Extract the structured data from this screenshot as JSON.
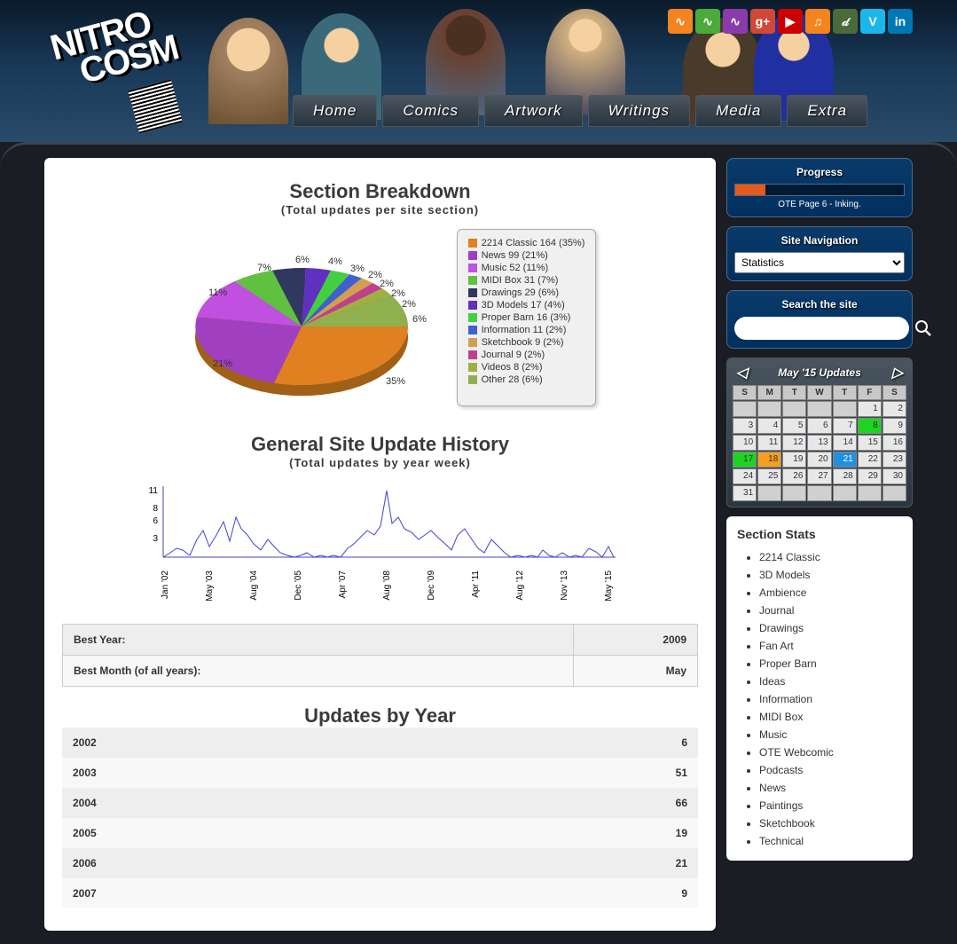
{
  "logo": {
    "line1": "NITRO",
    "line2": "COSM"
  },
  "social": [
    {
      "name": "rss",
      "bg": "#f5841f",
      "glyph": "∿"
    },
    {
      "name": "rss-green",
      "bg": "#4aaa3a",
      "glyph": "∿"
    },
    {
      "name": "rss-purple",
      "bg": "#8a3aaa",
      "glyph": "∿"
    },
    {
      "name": "googleplus",
      "bg": "#d14836",
      "glyph": "g+"
    },
    {
      "name": "youtube",
      "bg": "#cc0000",
      "glyph": "▶"
    },
    {
      "name": "soundcloud",
      "bg": "#f5841f",
      "glyph": "♫"
    },
    {
      "name": "deviantart",
      "bg": "#4a6a3a",
      "glyph": "𝒹"
    },
    {
      "name": "vimeo",
      "bg": "#1ab7ea",
      "glyph": "V"
    },
    {
      "name": "linkedin",
      "bg": "#0077b5",
      "glyph": "in"
    }
  ],
  "nav": [
    "Home",
    "Comics",
    "Artwork",
    "Writings",
    "Media",
    "Extra"
  ],
  "progress": {
    "title": "Progress",
    "pct": 18,
    "text": "OTE Page 6 - Inking."
  },
  "siteNav": {
    "title": "Site Navigation",
    "selected": "Statistics"
  },
  "search": {
    "title": "Search the site",
    "placeholder": ""
  },
  "calendar": {
    "title": "May '15 Updates",
    "dows": [
      "S",
      "M",
      "T",
      "W",
      "T",
      "F",
      "S"
    ],
    "cells": [
      {
        "d": "",
        "c": "empty"
      },
      {
        "d": "",
        "c": "empty"
      },
      {
        "d": "",
        "c": "empty"
      },
      {
        "d": "",
        "c": "empty"
      },
      {
        "d": "",
        "c": "empty"
      },
      {
        "d": "1"
      },
      {
        "d": "2"
      },
      {
        "d": "3"
      },
      {
        "d": "4"
      },
      {
        "d": "5"
      },
      {
        "d": "6"
      },
      {
        "d": "7"
      },
      {
        "d": "8",
        "c": "green"
      },
      {
        "d": "9"
      },
      {
        "d": "10"
      },
      {
        "d": "11"
      },
      {
        "d": "12"
      },
      {
        "d": "13"
      },
      {
        "d": "14"
      },
      {
        "d": "15"
      },
      {
        "d": "16"
      },
      {
        "d": "17",
        "c": "green"
      },
      {
        "d": "18",
        "c": "orange"
      },
      {
        "d": "19"
      },
      {
        "d": "20"
      },
      {
        "d": "21",
        "c": "blue"
      },
      {
        "d": "22"
      },
      {
        "d": "23"
      },
      {
        "d": "24"
      },
      {
        "d": "25"
      },
      {
        "d": "26"
      },
      {
        "d": "27"
      },
      {
        "d": "28"
      },
      {
        "d": "29"
      },
      {
        "d": "30"
      },
      {
        "d": "31"
      },
      {
        "d": "",
        "c": "empty"
      },
      {
        "d": "",
        "c": "empty"
      },
      {
        "d": "",
        "c": "empty"
      },
      {
        "d": "",
        "c": "empty"
      },
      {
        "d": "",
        "c": "empty"
      },
      {
        "d": "",
        "c": "empty"
      }
    ]
  },
  "sectionStats": {
    "title": "Section Stats",
    "items": [
      "2214 Classic",
      "3D Models",
      "Ambience",
      "Journal",
      "Drawings",
      "Fan Art",
      "Proper Barn",
      "Ideas",
      "Information",
      "MIDI Box",
      "Music",
      "OTE Webcomic",
      "Podcasts",
      "News",
      "Paintings",
      "Sketchbook",
      "Technical"
    ]
  },
  "pie": {
    "title": "Section Breakdown",
    "sub": "(Total updates per site section)",
    "legend": [
      {
        "label": "2214 Classic 164 (35%)",
        "color": "#e08020"
      },
      {
        "label": "News 99 (21%)",
        "color": "#a040c0"
      },
      {
        "label": "Music 52 (11%)",
        "color": "#c050e0"
      },
      {
        "label": "MIDI Box 31 (7%)",
        "color": "#60c040"
      },
      {
        "label": "Drawings 29 (6%)",
        "color": "#303860"
      },
      {
        "label": "3D Models 17 (4%)",
        "color": "#6030c0"
      },
      {
        "label": "Proper Barn 16 (3%)",
        "color": "#40d040"
      },
      {
        "label": "Information 11 (2%)",
        "color": "#4060d0"
      },
      {
        "label": "Sketchbook 9 (2%)",
        "color": "#d0a050"
      },
      {
        "label": "Journal 9 (2%)",
        "color": "#c04090"
      },
      {
        "label": "Videos 8 (2%)",
        "color": "#a0b040"
      },
      {
        "label": "Other 28 (6%)",
        "color": "#90b050"
      }
    ]
  },
  "history": {
    "title": "General Site Update History",
    "sub": "(Total updates by year week)"
  },
  "bestTable": [
    {
      "k": "Best Year:",
      "v": "2009"
    },
    {
      "k": "Best Month (of all years):",
      "v": "May"
    }
  ],
  "yrTitle": "Updates by Year",
  "yrTable": [
    {
      "k": "2002",
      "v": "6"
    },
    {
      "k": "2003",
      "v": "51"
    },
    {
      "k": "2004",
      "v": "66"
    },
    {
      "k": "2005",
      "v": "19"
    },
    {
      "k": "2006",
      "v": "21"
    },
    {
      "k": "2007",
      "v": "9"
    }
  ],
  "chart_data": [
    {
      "type": "pie",
      "title": "Section Breakdown",
      "subtitle": "(Total updates per site section)",
      "series": [
        {
          "name": "Updates",
          "values": [
            164,
            99,
            52,
            31,
            29,
            17,
            16,
            11,
            9,
            9,
            8,
            28
          ]
        }
      ],
      "categories": [
        "2214 Classic",
        "News",
        "Music",
        "MIDI Box",
        "Drawings",
        "3D Models",
        "Proper Barn",
        "Information",
        "Sketchbook",
        "Journal",
        "Videos",
        "Other"
      ],
      "percentages": [
        35,
        21,
        11,
        7,
        6,
        4,
        3,
        2,
        2,
        2,
        2,
        6
      ]
    },
    {
      "type": "line",
      "title": "General Site Update History",
      "subtitle": "(Total updates by year week)",
      "xlabel": "",
      "ylabel": "",
      "ylim": [
        0,
        11
      ],
      "yticks": [
        3,
        6,
        8,
        11
      ],
      "x_ticks": [
        "Jan '02",
        "May '03",
        "Aug '04",
        "Dec '05",
        "Apr '07",
        "Aug '08",
        "Dec '09",
        "Apr '11",
        "Aug '12",
        "Nov '13",
        "May '15"
      ],
      "note": "Weekly counts; sparse spiky series with max ~11 around late 2008, mostly 0-4 range"
    },
    {
      "type": "table",
      "title": "Updates by Year",
      "categories": [
        "2002",
        "2003",
        "2004",
        "2005",
        "2006",
        "2007"
      ],
      "values": [
        6,
        51,
        66,
        19,
        21,
        9
      ]
    }
  ]
}
